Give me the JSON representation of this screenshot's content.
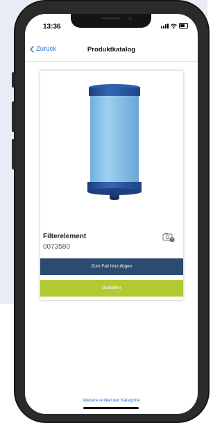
{
  "status_bar": {
    "time": "13:36"
  },
  "nav": {
    "back_label": "Zurück",
    "title": "Produktkatalog"
  },
  "product": {
    "name": "Filterelement",
    "number": "0073580",
    "image_icon": "filter-cartridge",
    "camera_icon": "camera-icon"
  },
  "actions": {
    "add_to_case": "Zum Fall hinzufügen",
    "order": "Bestellen"
  },
  "footer": {
    "more_link": "Weitere Artikel der Kategorie"
  },
  "colors": {
    "accent_blue": "#1f73d6",
    "primary_button": "#2b4c6e",
    "order_button": "#b5c935",
    "filter_body": "#8ec3e6",
    "filter_cap": "#2a5aa6"
  }
}
